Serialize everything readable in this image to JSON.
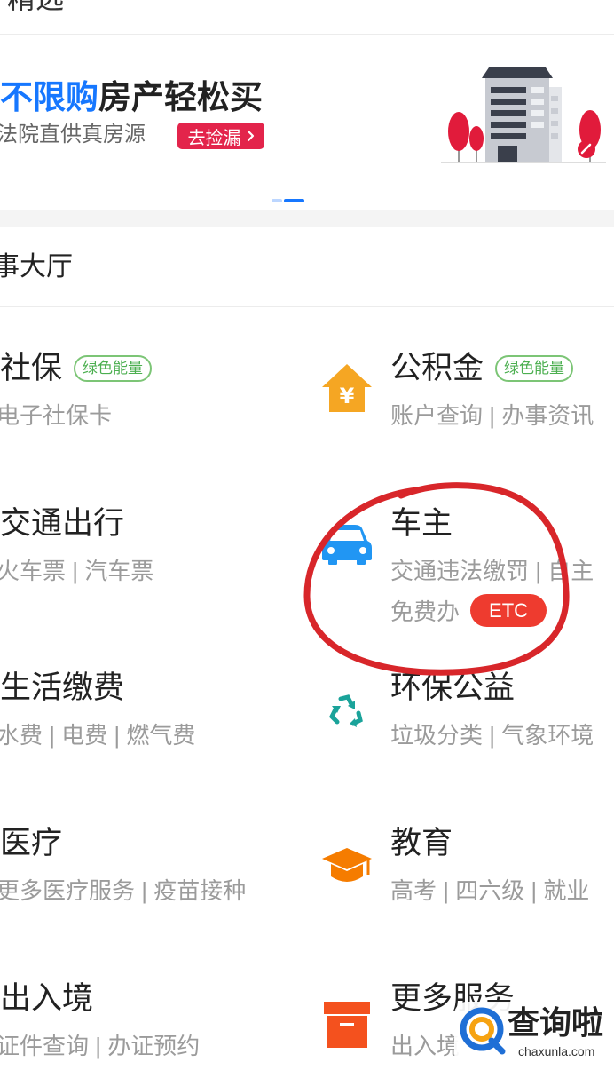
{
  "top_section": {
    "title": "精选"
  },
  "banner": {
    "headline_accent": "不限购",
    "headline_rest": "房产轻松买",
    "subline": "法院直供真房源",
    "cta_label": "去捡漏",
    "cta_icon": "chevron-right-icon",
    "illustration": "building-illustration"
  },
  "carousel_indicator": {
    "count": 2,
    "active": 2
  },
  "hall": {
    "title": "事大厅"
  },
  "services": {
    "left": [
      {
        "title": "社保",
        "badge": "绿色能量",
        "subtitle": "电子社保卡"
      },
      {
        "title": "交通出行",
        "subtitle": "火车票 | 汽车票"
      },
      {
        "title": "生活缴费",
        "subtitle": "水费 | 电费 | 燃气费"
      },
      {
        "title": "医疗",
        "subtitle": "更多医疗服务 | 疫苗接种"
      },
      {
        "title": "出入境",
        "subtitle": "证件查询 | 办证预约"
      }
    ],
    "right": [
      {
        "icon": "housing-fund-icon",
        "title": "公积金",
        "badge": "绿色能量",
        "subtitle": "账户查询 | 办事资讯"
      },
      {
        "icon": "car-icon",
        "title": "车主",
        "subtitle": "交通违法缴罚 | 自主",
        "extra": "免费办",
        "extra_badge": "ETC"
      },
      {
        "icon": "recycle-icon",
        "title": "环保公益",
        "subtitle": "垃圾分类 | 气象环境"
      },
      {
        "icon": "graduation-cap-icon",
        "title": "教育",
        "subtitle": "高考 | 四六级 | 就业"
      },
      {
        "icon": "box-icon",
        "title": "更多服务",
        "subtitle": "出入境"
      }
    ]
  },
  "annotation": {
    "shape": "hand-drawn-ellipse",
    "color": "#d8262a"
  },
  "watermark": {
    "logo": "magnifier-q-logo",
    "brand": "查询啦",
    "domain": "chaxunla.com"
  },
  "colors": {
    "accent_blue": "#1677ff",
    "badge_green": "#4caf50",
    "cta_red": "#e3244b",
    "etc_red": "#ee3b2f",
    "annotation_red": "#d8262a",
    "icon_orange": "#f39c12",
    "icon_blue": "#2196f3",
    "icon_teal": "#1aa39a"
  }
}
